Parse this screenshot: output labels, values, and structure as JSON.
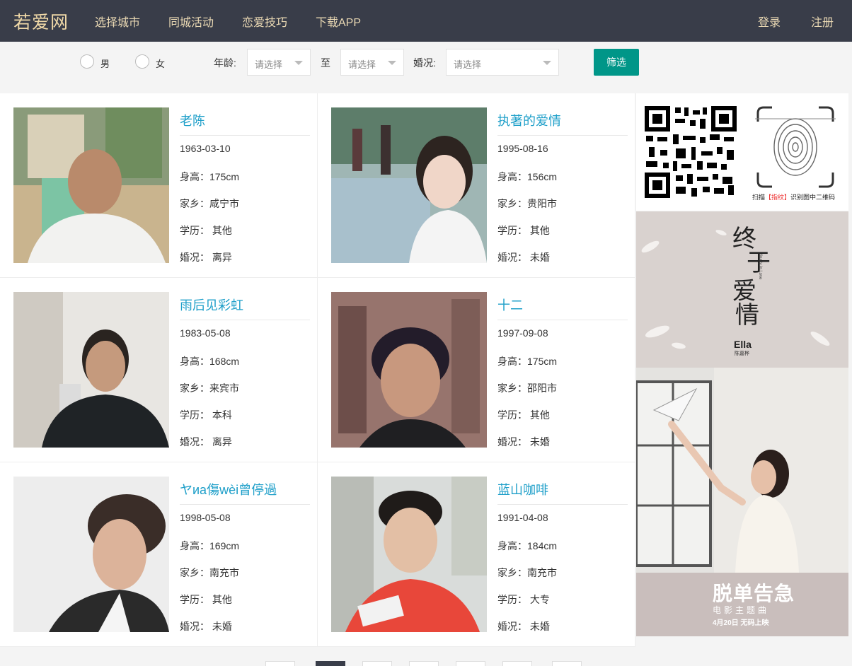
{
  "header": {
    "logo": "若爱网",
    "nav": [
      "选择城市",
      "同城活动",
      "恋爱技巧",
      "下载APP"
    ],
    "login": "登录",
    "register": "注册"
  },
  "filter": {
    "male": "男",
    "female": "女",
    "age_label": "年龄:",
    "to_label": "至",
    "marriage_label": "婚况:",
    "age_from_placeholder": "请选择",
    "age_to_placeholder": "请选择",
    "marriage_placeholder": "请选择",
    "button": "筛选"
  },
  "profiles": [
    {
      "name": "老陈",
      "birth": "1963-03-10",
      "height": "身高：175cm",
      "hometown": "家乡：咸宁市",
      "education": "学历： 其他",
      "marital": "婚况： 离异"
    },
    {
      "name": "执著的爱情",
      "birth": "1995-08-16",
      "height": "身高：156cm",
      "hometown": "家乡：贵阳市",
      "education": "学历： 其他",
      "marital": "婚况： 未婚"
    },
    {
      "name": "雨后见彩虹",
      "birth": "1983-05-08",
      "height": "身高：168cm",
      "hometown": "家乡：来宾市",
      "education": "学历： 本科",
      "marital": "婚况： 离异"
    },
    {
      "name": "十二",
      "birth": "1997-09-08",
      "height": "身高：175cm",
      "hometown": "家乡：邵阳市",
      "education": "学历： 其他",
      "marital": "婚况： 未婚"
    },
    {
      "name": "ヤиa傷wèi曾停過",
      "birth": "1998-05-08",
      "height": "身高：169cm",
      "hometown": "家乡：南充市",
      "education": "学历： 其他",
      "marital": "婚况： 未婚"
    },
    {
      "name": "蓝山咖啡",
      "birth": "1991-04-08",
      "height": "身高：184cm",
      "hometown": "家乡：南充市",
      "education": "学历： 大专",
      "marital": "婚况： 未婚"
    }
  ],
  "sidebar": {
    "qr_caption_a": "扫描",
    "qr_caption_b": "【指纹】",
    "qr_caption_c": "识别图中二维码",
    "ad1_title_a": "终",
    "ad1_title_b": "于",
    "ad1_title_c": "爱",
    "ad1_title_d": "情",
    "ad1_subtitle": "finally in Love",
    "ad1_artist": "Ella",
    "ad1_artist_cn": "陈嘉桦",
    "ad2_title": "脱单告急",
    "ad2_subtitle": "电影主题曲",
    "ad2_date": "4月20日 无码上映"
  },
  "colors": {
    "header_bg": "#393d49",
    "nav_text": "#e9d8b3",
    "accent": "#009688",
    "name_link": "#1e9fc9"
  }
}
